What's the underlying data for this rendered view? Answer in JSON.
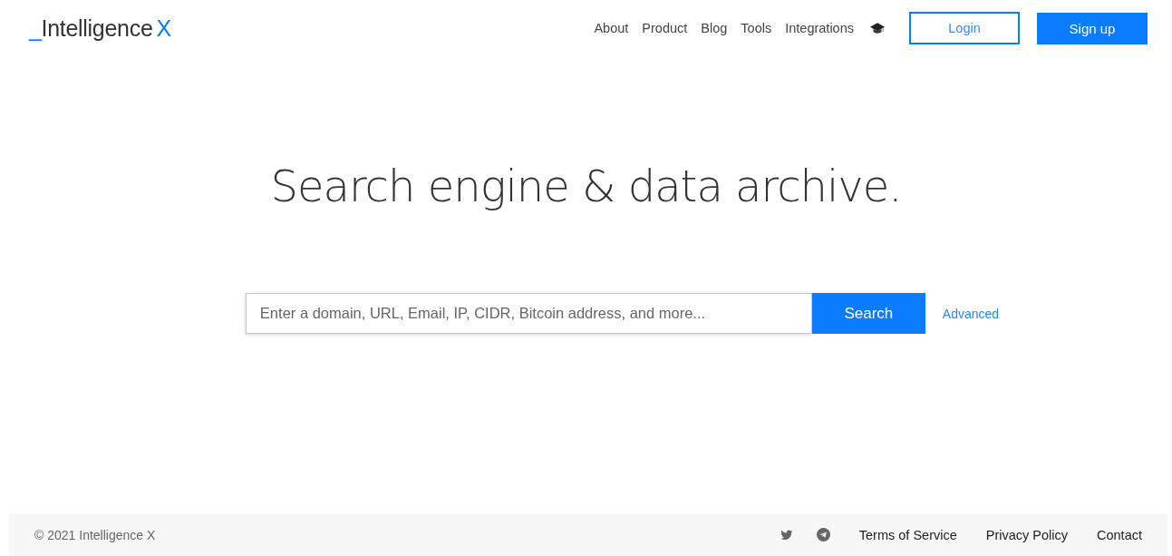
{
  "logo": {
    "prefix": "_",
    "name": "Intelligence",
    "suffix": "X"
  },
  "nav": [
    "About",
    "Product",
    "Blog",
    "Tools",
    "Integrations"
  ],
  "login": "Login",
  "signup": "Sign up",
  "headline": "Search engine & data archive.",
  "search": {
    "placeholder": "Enter a domain, URL, Email, IP, CIDR, Bitcoin address, and more...",
    "button": "Search",
    "advanced": "Advanced"
  },
  "footer": {
    "copyright": "© 2021 Intelligence X",
    "links": [
      "Terms of Service",
      "Privacy Policy",
      "Contact"
    ]
  }
}
